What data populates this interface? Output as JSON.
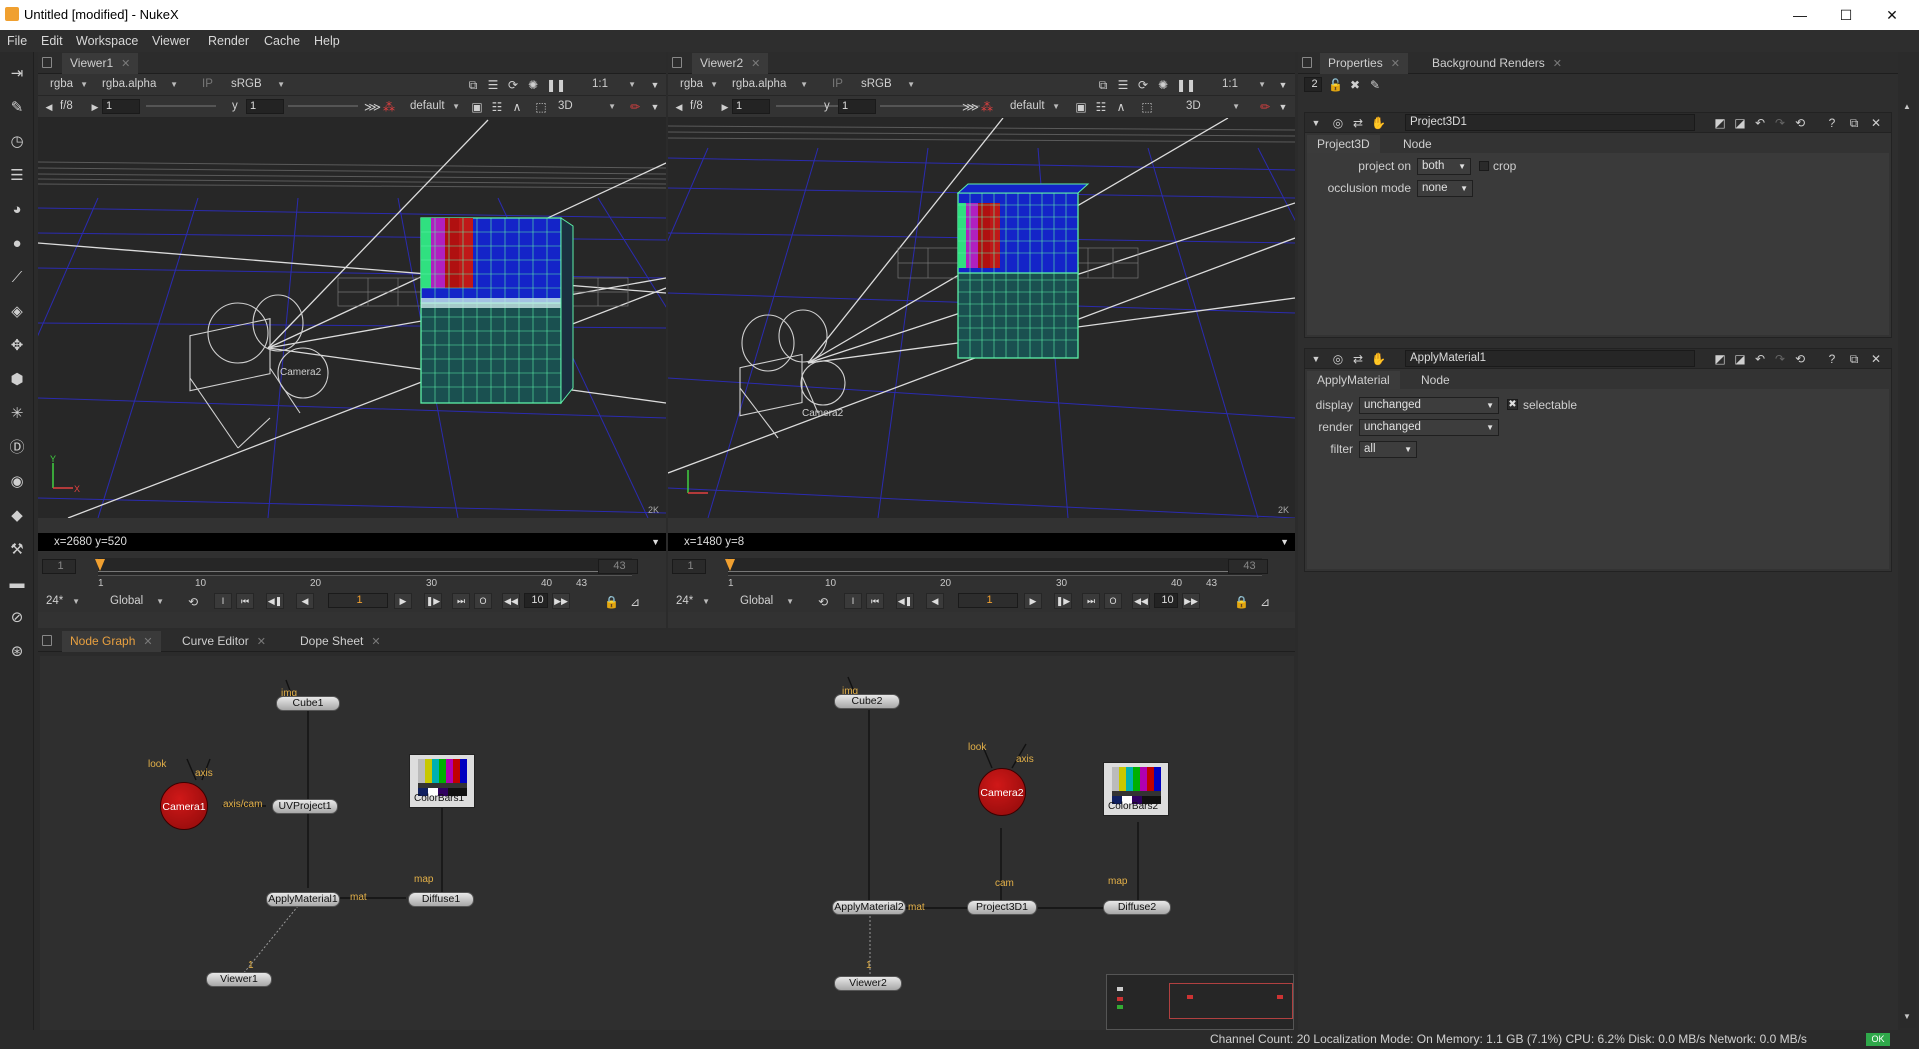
{
  "window": {
    "title": "Untitled [modified] - NukeX",
    "minimize": "—",
    "maximize": "☐",
    "close": "✕"
  },
  "menu": [
    "File",
    "Edit",
    "Workspace",
    "Viewer",
    "Render",
    "Cache",
    "Help"
  ],
  "viewer1": {
    "tab": "Viewer1",
    "channels": "rgba",
    "alpha": "rgba.alpha",
    "ip": "IP",
    "lut": "sRGB",
    "zoom": "1:1",
    "fstop": "f/8",
    "gain": "1",
    "gamma_label": "y",
    "gamma": "1",
    "grade": "default",
    "mode": "3D",
    "coords": "x=2680 y=520",
    "corner": "2K",
    "camera_label": "Camera2",
    "timeline": {
      "start": "1",
      "end": "43",
      "ticks": [
        "1",
        "10",
        "20",
        "30",
        "40",
        "43"
      ]
    },
    "fps": "24*",
    "range": "Global",
    "frame": "1",
    "inc": "10",
    "in": "I",
    "out": "O"
  },
  "viewer2": {
    "tab": "Viewer2",
    "channels": "rgba",
    "alpha": "rgba.alpha",
    "ip": "IP",
    "lut": "sRGB",
    "zoom": "1:1",
    "fstop": "f/8",
    "gain": "1",
    "gamma_label": "y",
    "gamma": "1",
    "grade": "default",
    "mode": "3D",
    "coords": "x=1480 y=8",
    "corner": "2K",
    "camera_label": "Camera2",
    "timeline": {
      "start": "1",
      "end": "43",
      "ticks": [
        "1",
        "10",
        "20",
        "30",
        "40",
        "43"
      ]
    },
    "fps": "24*",
    "range": "Global",
    "frame": "1",
    "inc": "10",
    "in": "I",
    "out": "O"
  },
  "bottom_tabs": [
    "Node Graph",
    "Curve Editor",
    "Dope Sheet"
  ],
  "nodes": {
    "cube1": "Cube1",
    "uvproject1": "UVProject1",
    "camera1": "Camera1",
    "colorbars1": "ColorBars1",
    "applymaterial1": "ApplyMaterial1",
    "diffuse1": "Diffuse1",
    "viewer1": "Viewer1",
    "cube2": "Cube2",
    "camera2": "Camera2",
    "colorbars2": "ColorBars2",
    "applymaterial2": "ApplyMaterial2",
    "project3d1": "Project3D1",
    "diffuse2": "Diffuse2",
    "viewer2": "Viewer2"
  },
  "edge_labels": {
    "img": "img",
    "look": "look",
    "axis": "axis",
    "axiscam": "axis/cam",
    "map": "map",
    "mat": "mat",
    "cam": "cam",
    "one": "1"
  },
  "right_tabs": [
    "Properties",
    "Background Renders"
  ],
  "properties": {
    "max_panels": "2",
    "project3d": {
      "name": "Project3D1",
      "tabs": [
        "Project3D",
        "Node"
      ],
      "project_on_label": "project on",
      "project_on": "both",
      "crop_label": "crop",
      "occlusion_label": "occlusion mode",
      "occlusion": "none"
    },
    "applymaterial": {
      "name": "ApplyMaterial1",
      "tabs": [
        "ApplyMaterial",
        "Node"
      ],
      "display_label": "display",
      "display": "unchanged",
      "selectable_label": "selectable",
      "render_label": "render",
      "render": "unchanged",
      "filter_label": "filter",
      "filter": "all"
    }
  },
  "statusbar": "Channel Count: 20  Localization Mode: On  Memory: 1.1 GB (7.1%)  CPU: 6.2%  Disk: 0.0 MB/s  Network: 0.0 MB/s",
  "status_ok": "OK",
  "colors": {
    "accent": "#f0a030",
    "camera_node": "#b01010",
    "grid": "#2b2bb0",
    "wire_cube": "#5cf0a8",
    "tab_highlight": "#e8a040"
  }
}
